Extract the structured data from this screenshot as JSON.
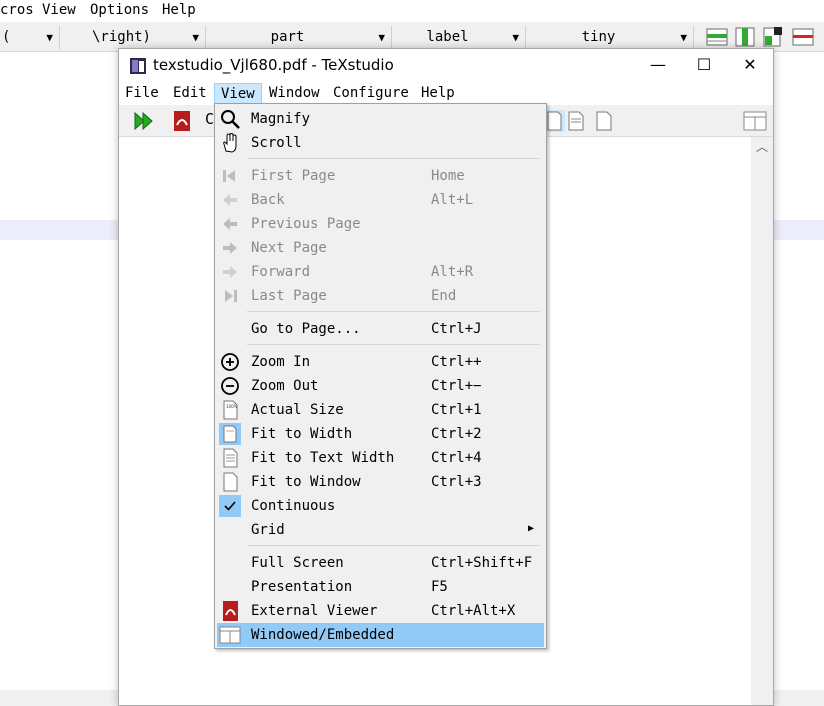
{
  "background": {
    "menu": [
      "cros",
      "View",
      "Options",
      "Help"
    ],
    "combos": [
      {
        "value": "(",
        "has_arrow": true
      },
      {
        "value": "\\right)"
      },
      {
        "value": "part"
      },
      {
        "value": "label"
      },
      {
        "value": "tiny"
      }
    ]
  },
  "window": {
    "title": "texstudio_Vjl680.pdf - TeXstudio",
    "minimize": "—",
    "maximize": "☐",
    "close": "✕"
  },
  "menubar": [
    "File",
    "Edit",
    "View",
    "Window",
    "Configure",
    "Help"
  ],
  "view_menu": {
    "magnify": {
      "label": "Magnify"
    },
    "scroll": {
      "label": "Scroll"
    },
    "first_page": {
      "label": "First Page",
      "shortcut": "Home"
    },
    "back": {
      "label": "Back",
      "shortcut": "Alt+L"
    },
    "previous_page": {
      "label": "Previous Page"
    },
    "next_page": {
      "label": "Next Page"
    },
    "forward": {
      "label": "Forward",
      "shortcut": "Alt+R"
    },
    "last_page": {
      "label": "Last Page",
      "shortcut": "End"
    },
    "go_to_page": {
      "label": "Go to Page...",
      "shortcut": "Ctrl+J"
    },
    "zoom_in": {
      "label": "Zoom In",
      "shortcut": "Ctrl++"
    },
    "zoom_out": {
      "label": "Zoom Out",
      "shortcut": "Ctrl+−"
    },
    "actual_size": {
      "label": "Actual Size",
      "shortcut": "Ctrl+1"
    },
    "fit_width": {
      "label": "Fit to Width",
      "shortcut": "Ctrl+2"
    },
    "fit_text_width": {
      "label": "Fit to Text Width",
      "shortcut": "Ctrl+4"
    },
    "fit_window": {
      "label": "Fit to Window",
      "shortcut": "Ctrl+3"
    },
    "continuous": {
      "label": "Continuous",
      "checked": true
    },
    "grid": {
      "label": "Grid",
      "submenu": true
    },
    "full_screen": {
      "label": "Full Screen",
      "shortcut": "Ctrl+Shift+F"
    },
    "presentation": {
      "label": "Presentation",
      "shortcut": "F5"
    },
    "external_viewer": {
      "label": "External Viewer",
      "shortcut": "Ctrl+Alt+X"
    },
    "windowed_embedded": {
      "label": "Windowed/Embedded",
      "highlighted": true
    }
  },
  "colors": {
    "menu_bg": "#f0f0f0",
    "highlight": "#91c9f7",
    "disabled_text": "#8a8a8a",
    "active_menu": "#cce8ff"
  }
}
